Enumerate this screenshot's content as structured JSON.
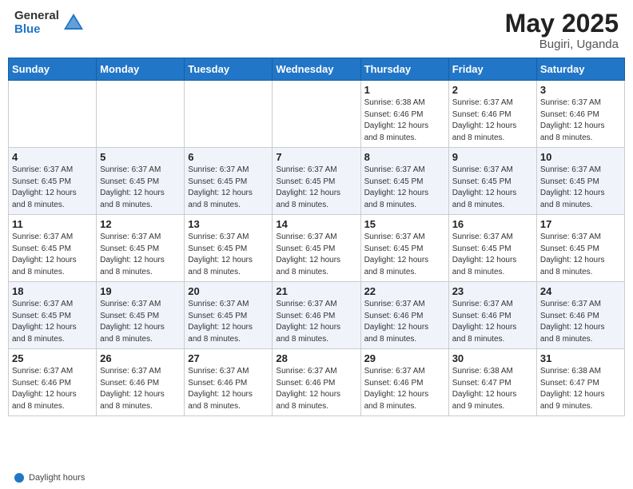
{
  "header": {
    "logo_general": "General",
    "logo_blue": "Blue",
    "title": "May 2025",
    "location": "Bugiri, Uganda"
  },
  "footer": {
    "label": "Daylight hours"
  },
  "weekdays": [
    "Sunday",
    "Monday",
    "Tuesday",
    "Wednesday",
    "Thursday",
    "Friday",
    "Saturday"
  ],
  "weeks": [
    [
      {
        "num": "",
        "detail": ""
      },
      {
        "num": "",
        "detail": ""
      },
      {
        "num": "",
        "detail": ""
      },
      {
        "num": "",
        "detail": ""
      },
      {
        "num": "1",
        "detail": "Sunrise: 6:38 AM\nSunset: 6:46 PM\nDaylight: 12 hours\nand 8 minutes."
      },
      {
        "num": "2",
        "detail": "Sunrise: 6:37 AM\nSunset: 6:46 PM\nDaylight: 12 hours\nand 8 minutes."
      },
      {
        "num": "3",
        "detail": "Sunrise: 6:37 AM\nSunset: 6:46 PM\nDaylight: 12 hours\nand 8 minutes."
      }
    ],
    [
      {
        "num": "4",
        "detail": "Sunrise: 6:37 AM\nSunset: 6:45 PM\nDaylight: 12 hours\nand 8 minutes."
      },
      {
        "num": "5",
        "detail": "Sunrise: 6:37 AM\nSunset: 6:45 PM\nDaylight: 12 hours\nand 8 minutes."
      },
      {
        "num": "6",
        "detail": "Sunrise: 6:37 AM\nSunset: 6:45 PM\nDaylight: 12 hours\nand 8 minutes."
      },
      {
        "num": "7",
        "detail": "Sunrise: 6:37 AM\nSunset: 6:45 PM\nDaylight: 12 hours\nand 8 minutes."
      },
      {
        "num": "8",
        "detail": "Sunrise: 6:37 AM\nSunset: 6:45 PM\nDaylight: 12 hours\nand 8 minutes."
      },
      {
        "num": "9",
        "detail": "Sunrise: 6:37 AM\nSunset: 6:45 PM\nDaylight: 12 hours\nand 8 minutes."
      },
      {
        "num": "10",
        "detail": "Sunrise: 6:37 AM\nSunset: 6:45 PM\nDaylight: 12 hours\nand 8 minutes."
      }
    ],
    [
      {
        "num": "11",
        "detail": "Sunrise: 6:37 AM\nSunset: 6:45 PM\nDaylight: 12 hours\nand 8 minutes."
      },
      {
        "num": "12",
        "detail": "Sunrise: 6:37 AM\nSunset: 6:45 PM\nDaylight: 12 hours\nand 8 minutes."
      },
      {
        "num": "13",
        "detail": "Sunrise: 6:37 AM\nSunset: 6:45 PM\nDaylight: 12 hours\nand 8 minutes."
      },
      {
        "num": "14",
        "detail": "Sunrise: 6:37 AM\nSunset: 6:45 PM\nDaylight: 12 hours\nand 8 minutes."
      },
      {
        "num": "15",
        "detail": "Sunrise: 6:37 AM\nSunset: 6:45 PM\nDaylight: 12 hours\nand 8 minutes."
      },
      {
        "num": "16",
        "detail": "Sunrise: 6:37 AM\nSunset: 6:45 PM\nDaylight: 12 hours\nand 8 minutes."
      },
      {
        "num": "17",
        "detail": "Sunrise: 6:37 AM\nSunset: 6:45 PM\nDaylight: 12 hours\nand 8 minutes."
      }
    ],
    [
      {
        "num": "18",
        "detail": "Sunrise: 6:37 AM\nSunset: 6:45 PM\nDaylight: 12 hours\nand 8 minutes."
      },
      {
        "num": "19",
        "detail": "Sunrise: 6:37 AM\nSunset: 6:45 PM\nDaylight: 12 hours\nand 8 minutes."
      },
      {
        "num": "20",
        "detail": "Sunrise: 6:37 AM\nSunset: 6:45 PM\nDaylight: 12 hours\nand 8 minutes."
      },
      {
        "num": "21",
        "detail": "Sunrise: 6:37 AM\nSunset: 6:46 PM\nDaylight: 12 hours\nand 8 minutes."
      },
      {
        "num": "22",
        "detail": "Sunrise: 6:37 AM\nSunset: 6:46 PM\nDaylight: 12 hours\nand 8 minutes."
      },
      {
        "num": "23",
        "detail": "Sunrise: 6:37 AM\nSunset: 6:46 PM\nDaylight: 12 hours\nand 8 minutes."
      },
      {
        "num": "24",
        "detail": "Sunrise: 6:37 AM\nSunset: 6:46 PM\nDaylight: 12 hours\nand 8 minutes."
      }
    ],
    [
      {
        "num": "25",
        "detail": "Sunrise: 6:37 AM\nSunset: 6:46 PM\nDaylight: 12 hours\nand 8 minutes."
      },
      {
        "num": "26",
        "detail": "Sunrise: 6:37 AM\nSunset: 6:46 PM\nDaylight: 12 hours\nand 8 minutes."
      },
      {
        "num": "27",
        "detail": "Sunrise: 6:37 AM\nSunset: 6:46 PM\nDaylight: 12 hours\nand 8 minutes."
      },
      {
        "num": "28",
        "detail": "Sunrise: 6:37 AM\nSunset: 6:46 PM\nDaylight: 12 hours\nand 8 minutes."
      },
      {
        "num": "29",
        "detail": "Sunrise: 6:37 AM\nSunset: 6:46 PM\nDaylight: 12 hours\nand 8 minutes."
      },
      {
        "num": "30",
        "detail": "Sunrise: 6:38 AM\nSunset: 6:47 PM\nDaylight: 12 hours\nand 9 minutes."
      },
      {
        "num": "31",
        "detail": "Sunrise: 6:38 AM\nSunset: 6:47 PM\nDaylight: 12 hours\nand 9 minutes."
      }
    ]
  ]
}
